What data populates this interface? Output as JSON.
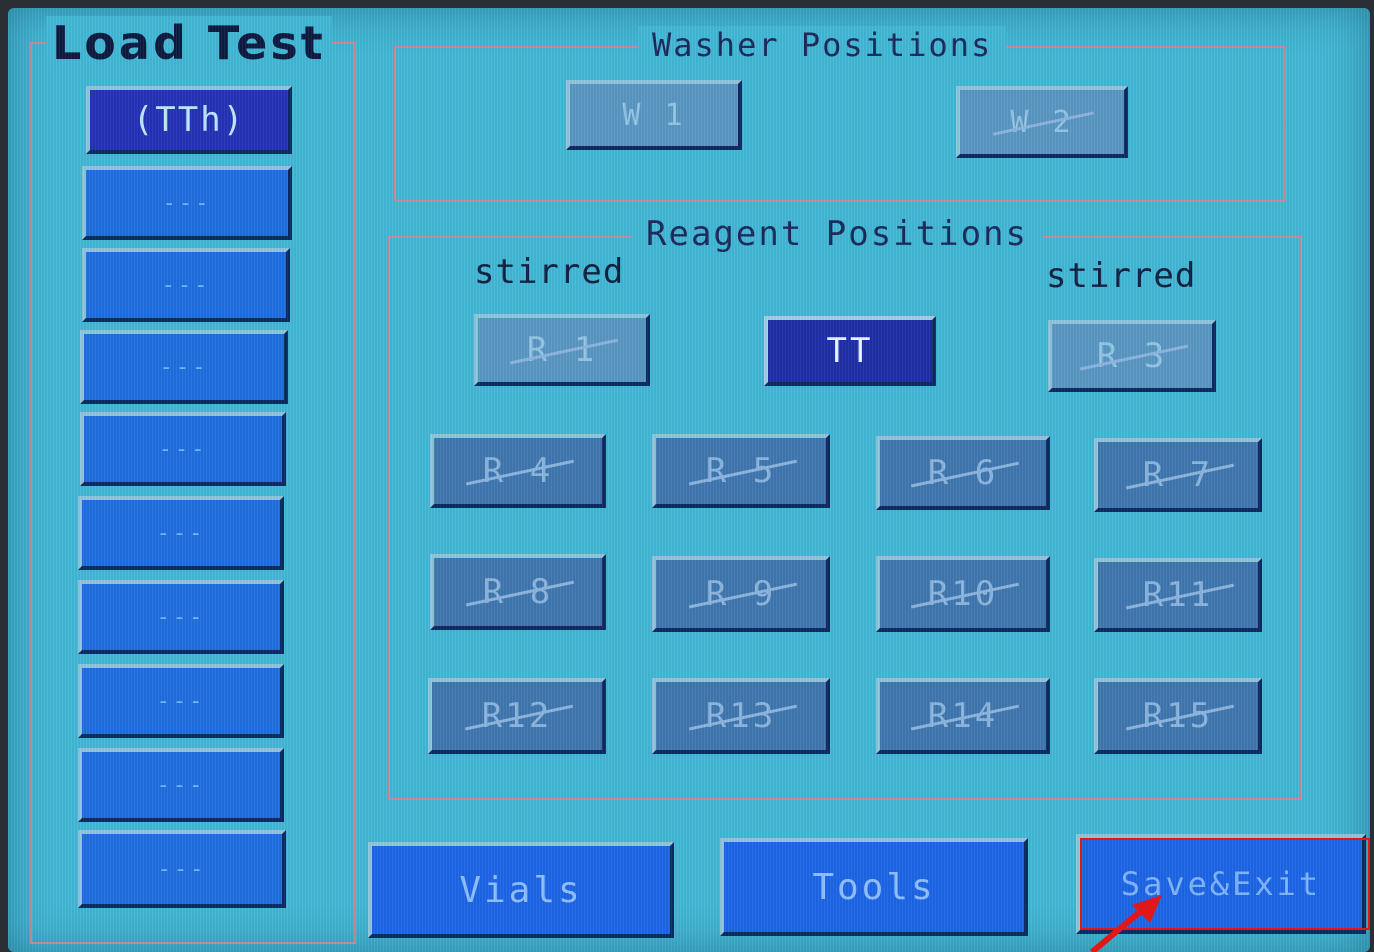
{
  "load_test": {
    "title": "Load Test",
    "slots": [
      {
        "label": "(TTh)"
      },
      {
        "label": "---"
      },
      {
        "label": "---"
      },
      {
        "label": "---"
      },
      {
        "label": "---"
      },
      {
        "label": "---"
      },
      {
        "label": "---"
      },
      {
        "label": "---"
      },
      {
        "label": "---"
      },
      {
        "label": "---"
      }
    ]
  },
  "washer": {
    "title": "Washer Positions",
    "positions": [
      {
        "label": "W 1"
      },
      {
        "label": "W 2"
      }
    ]
  },
  "reagent": {
    "title": "Reagent Positions",
    "stirred_left": "stirred",
    "stirred_right": "stirred",
    "positions": [
      {
        "label": "R 1"
      },
      {
        "label": "TT"
      },
      {
        "label": "R 3"
      },
      {
        "label": "R 4"
      },
      {
        "label": "R 5"
      },
      {
        "label": "R 6"
      },
      {
        "label": "R 7"
      },
      {
        "label": "R 8"
      },
      {
        "label": "R 9"
      },
      {
        "label": "R10"
      },
      {
        "label": "R11"
      },
      {
        "label": "R12"
      },
      {
        "label": "R13"
      },
      {
        "label": "R14"
      },
      {
        "label": "R15"
      }
    ]
  },
  "footer": {
    "vials": "Vials",
    "tools": "Tools",
    "save_exit": "Save&Exit"
  },
  "colors": {
    "screen_bg": "#42b8d6",
    "slot_blue": "#1f6fe0",
    "selected": "#2433b8",
    "disabled_position": "#3f78b0",
    "annotation_red": "#e01818"
  }
}
